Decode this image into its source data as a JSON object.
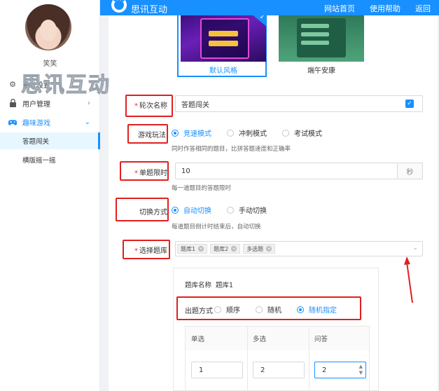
{
  "header": {
    "brand": "思讯互动",
    "links": [
      "网站首页",
      "使用帮助",
      "返回"
    ]
  },
  "sidebar": {
    "username": "笑笑",
    "watermark": "思讯互动",
    "menu": [
      {
        "label": "系统设置",
        "icon": "gear-icon"
      },
      {
        "label": "用户管理",
        "icon": "lock-icon"
      },
      {
        "label": "趣味游戏",
        "icon": "gamepad-icon"
      }
    ],
    "submenu": [
      "答题闯关",
      "横版摇一摇"
    ]
  },
  "themes": [
    {
      "label": "默认风格",
      "selected": true
    },
    {
      "label": "端午安康",
      "selected": false
    }
  ],
  "form": {
    "round_name": {
      "label": "轮次名称",
      "value": "答题闯关"
    },
    "game_mode": {
      "label": "游戏玩法",
      "options": [
        "竞速模式",
        "冲刺模式",
        "考试模式"
      ],
      "selected": 0,
      "hint": "同时作答相同的题目，比拼答题速度和正确率"
    },
    "time_limit": {
      "label": "单题限时",
      "value": "10",
      "unit": "秒",
      "hint": "每一道题目的答题限时"
    },
    "switch_mode": {
      "label": "切换方式",
      "options": [
        "自动切换",
        "手动切换"
      ],
      "selected": 0,
      "hint": "每道题目倒计时结束后，自动切换"
    },
    "question_bank": {
      "label": "选择题库",
      "tags": [
        "题库1",
        "题库2",
        "多选题"
      ]
    }
  },
  "bank_detail": {
    "name_label": "题库名称",
    "name_value": "题库1",
    "method_label": "出题方式",
    "methods": [
      "顺序",
      "随机",
      "随机指定"
    ],
    "method_selected": 2,
    "columns": [
      "单选",
      "多选",
      "问答"
    ],
    "values": [
      "1",
      "2",
      "2"
    ]
  },
  "colors": {
    "primary": "#1890ff",
    "annotation": "#e02020"
  }
}
